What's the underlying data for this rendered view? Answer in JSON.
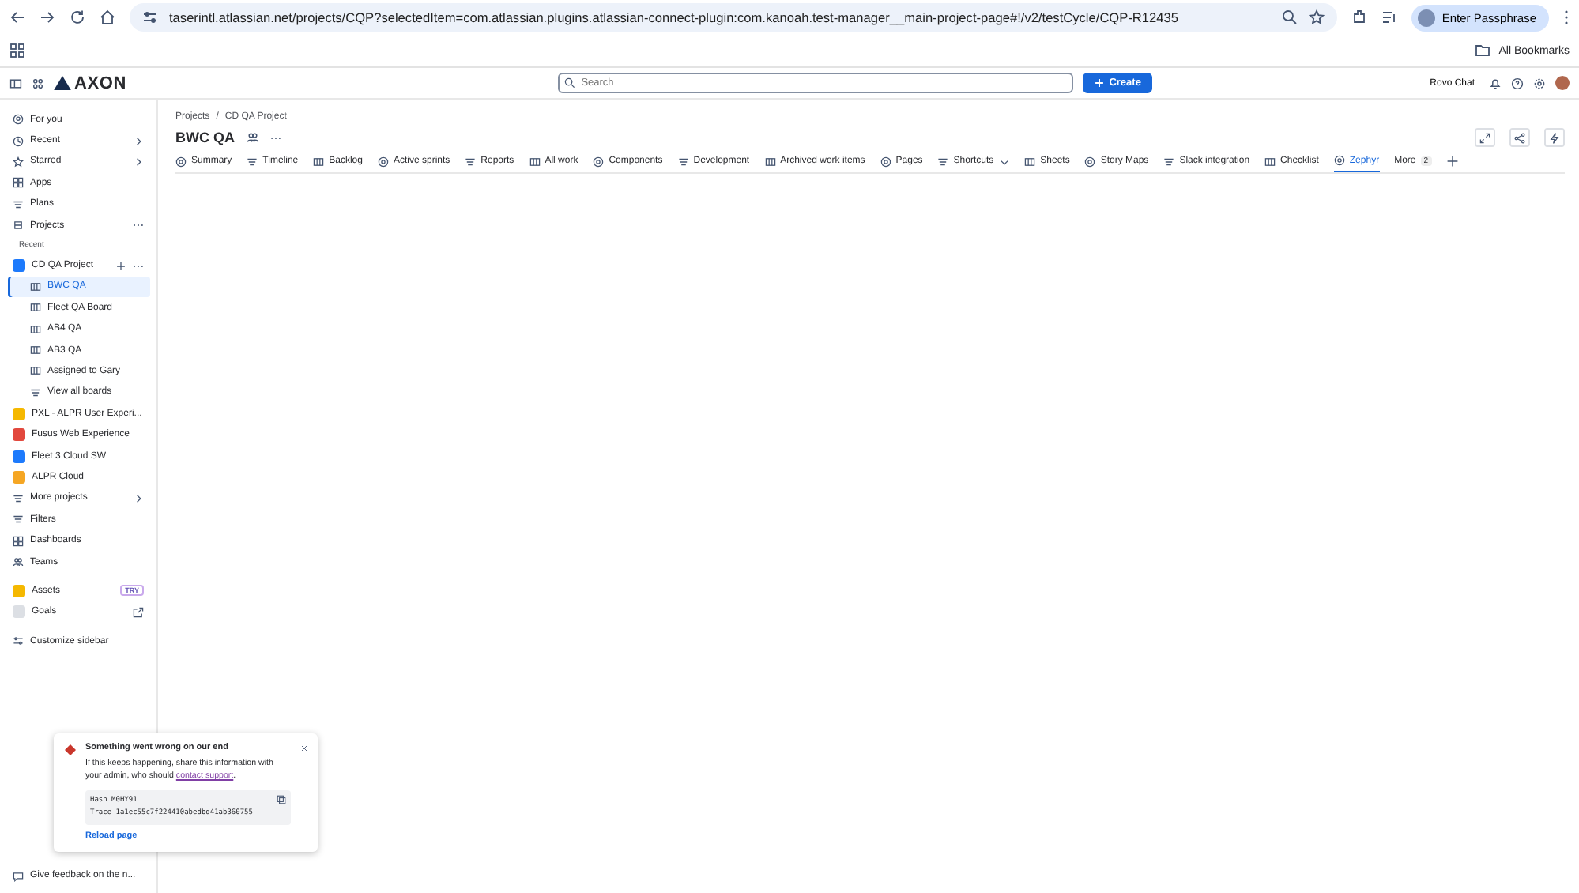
{
  "browser": {
    "url": "taserintl.atlassian.net/projects/CQP?selectedItem=com.atlassian.plugins.atlassian-connect-plugin:com.kanoah.test-manager__main-project-page#!/v2/testCycle/CQP-R12435",
    "profile_button": "Enter Passphrase",
    "bookmarks": "All Bookmarks"
  },
  "topbar": {
    "logo": "AXON",
    "search_placeholder": "Search",
    "create": "Create",
    "rovo": "Rovo Chat"
  },
  "sidebar": {
    "top": [
      {
        "label": "For you",
        "submenu": false,
        "more": false
      },
      {
        "label": "Recent",
        "submenu": true,
        "more": false
      },
      {
        "label": "Starred",
        "submenu": true,
        "more": false
      },
      {
        "label": "Apps",
        "submenu": false,
        "more": false
      },
      {
        "label": "Plans",
        "submenu": false,
        "more": false
      },
      {
        "label": "Projects",
        "submenu": false,
        "more": true
      }
    ],
    "section_label": "Recent",
    "projects": [
      {
        "label": "CD QA Project",
        "color": "#1d7afc",
        "children": [
          {
            "label": "BWC QA",
            "kind": "board",
            "selected": true
          },
          {
            "label": "Fleet QA Board",
            "kind": "board",
            "selected": false
          },
          {
            "label": "AB4 QA",
            "kind": "board",
            "selected": false
          },
          {
            "label": "AB3 QA",
            "kind": "board",
            "selected": false
          },
          {
            "label": "Assigned to Gary",
            "kind": "board",
            "selected": false
          },
          {
            "label": "View all boards",
            "kind": "list",
            "selected": false
          }
        ]
      },
      {
        "label": "PXL - ALPR User Experi...",
        "color": "#f5b800"
      },
      {
        "label": "Fusus Web Experience",
        "color": "#e2483d"
      },
      {
        "label": "Fleet 3 Cloud SW",
        "color": "#1d7afc"
      },
      {
        "label": "ALPR Cloud",
        "color": "#f5a623"
      }
    ],
    "more_projects": "More projects",
    "bottom": [
      {
        "label": "Filters"
      },
      {
        "label": "Dashboards"
      },
      {
        "label": "Teams"
      }
    ],
    "apps": [
      {
        "label": "Assets",
        "badge": "TRY",
        "external": false
      },
      {
        "label": "Goals",
        "external": true
      }
    ],
    "customize": "Customize sidebar",
    "feedback": "Give feedback on the n..."
  },
  "main": {
    "breadcrumbs": [
      "Projects",
      "CD QA Project"
    ],
    "breadcrumb_separator": "/",
    "title": "BWC QA",
    "tabs": [
      {
        "label": "Summary",
        "selected": false,
        "dropdown": false
      },
      {
        "label": "Timeline",
        "selected": false,
        "dropdown": false
      },
      {
        "label": "Backlog",
        "selected": false,
        "dropdown": false
      },
      {
        "label": "Active sprints",
        "selected": false,
        "dropdown": false
      },
      {
        "label": "Reports",
        "selected": false,
        "dropdown": false
      },
      {
        "label": "All work",
        "selected": false,
        "dropdown": false
      },
      {
        "label": "Components",
        "selected": false,
        "dropdown": false
      },
      {
        "label": "Development",
        "selected": false,
        "dropdown": false
      },
      {
        "label": "Archived work items",
        "selected": false,
        "dropdown": false
      },
      {
        "label": "Pages",
        "selected": false,
        "dropdown": false
      },
      {
        "label": "Shortcuts",
        "selected": false,
        "dropdown": true
      },
      {
        "label": "Sheets",
        "selected": false,
        "dropdown": false
      },
      {
        "label": "Story Maps",
        "selected": false,
        "dropdown": false
      },
      {
        "label": "Slack integration",
        "selected": false,
        "dropdown": false
      },
      {
        "label": "Checklist",
        "selected": false,
        "dropdown": false
      },
      {
        "label": "Zephyr",
        "selected": true,
        "dropdown": false
      }
    ],
    "more": {
      "label": "More",
      "count": "2"
    }
  },
  "error_toast": {
    "title": "Something went wrong on our end",
    "message": "If this keeps happening, share this information with your admin, who should",
    "link": "contact support",
    "message_end": ".",
    "hash": "Hash M0HY91",
    "trace": "Trace 1a1ec55c7f224410abedbd41ab360755",
    "action": "Reload page"
  }
}
